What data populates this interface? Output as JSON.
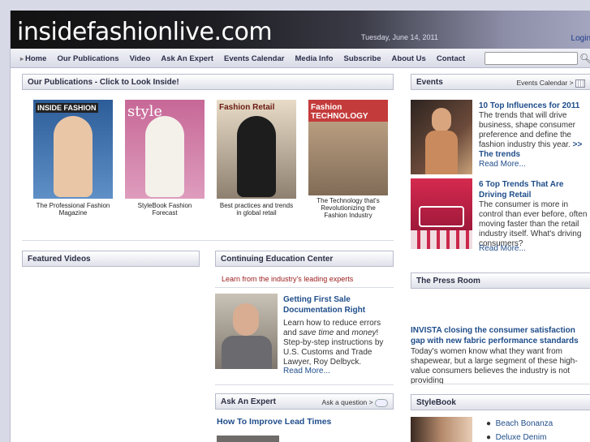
{
  "header": {
    "logo_main": "insidefashion",
    "logo_live": "live",
    "logo_tld": ".com",
    "date": "Tuesday, June 14, 2011",
    "login": "Login"
  },
  "nav": {
    "items": [
      "Home",
      "Our Publications",
      "Video",
      "Ask An Expert",
      "Events Calendar",
      "Media Info",
      "Subscribe",
      "About Us",
      "Contact"
    ],
    "search_placeholder": ""
  },
  "publications": {
    "title": "Our Publications - Click to Look Inside!",
    "items": [
      {
        "cover_title": "INSIDE FASHION",
        "caption": "The Professional Fashion Magazine",
        "color": "#3a6ea8"
      },
      {
        "cover_title": "style",
        "caption": "StyleBook Fashion Forecast",
        "color": "#c05a8e"
      },
      {
        "cover_title": "Fashion Retail",
        "caption": "Best practices and trends in global retail",
        "color": "#5b4a3f"
      },
      {
        "cover_title": "Fashion TECHNOLOGY",
        "caption": "The Technology that's Revolutionizing the Fashion Industry",
        "color": "#7b6b5a"
      }
    ]
  },
  "events": {
    "title": "Events",
    "calendar_link": "Events Calendar >",
    "items": [
      {
        "headline": "10 Top Influences for 2011",
        "body": "The trends that will drive business, shape consumer preference and define the fashion industry this year.",
        "link": ">> The trends",
        "more": "Read More..."
      },
      {
        "headline": "6 Top Trends That Are Driving Retail",
        "body": "The consumer is more in control than ever before, often moving faster than the retail industry itself.  What's driving consumers?",
        "more": "Read More..."
      }
    ]
  },
  "videos": {
    "title": "Featured Videos"
  },
  "education": {
    "title": "Continuing Education Center",
    "tagline": "Learn from the industry's leading experts",
    "headline": "Getting First Sale Documentation Right",
    "body_1": "Learn how to reduce errors and ",
    "body_em1": "save time",
    "body_2": " and ",
    "body_em2": "money",
    "body_3": "! Step-by-step instructions by U.S. Customs and Trade Lawyer, Roy Delbyck.",
    "more": "Read More..."
  },
  "press": {
    "title": "The Press Room",
    "headline": "INVISTA closing the consumer satisfaction gap with new fabric performance standards",
    "body": "Today's women know what they want from shapewear, but a large segment of these high-value consumers believes the industry is not providing"
  },
  "expert": {
    "title": "Ask An Expert",
    "ask_link": "Ask a question >",
    "headline": "How To Improve Lead Times"
  },
  "stylebook": {
    "title": "StyleBook",
    "items": [
      "Beach Bonanza",
      "Deluxe Denim"
    ]
  }
}
